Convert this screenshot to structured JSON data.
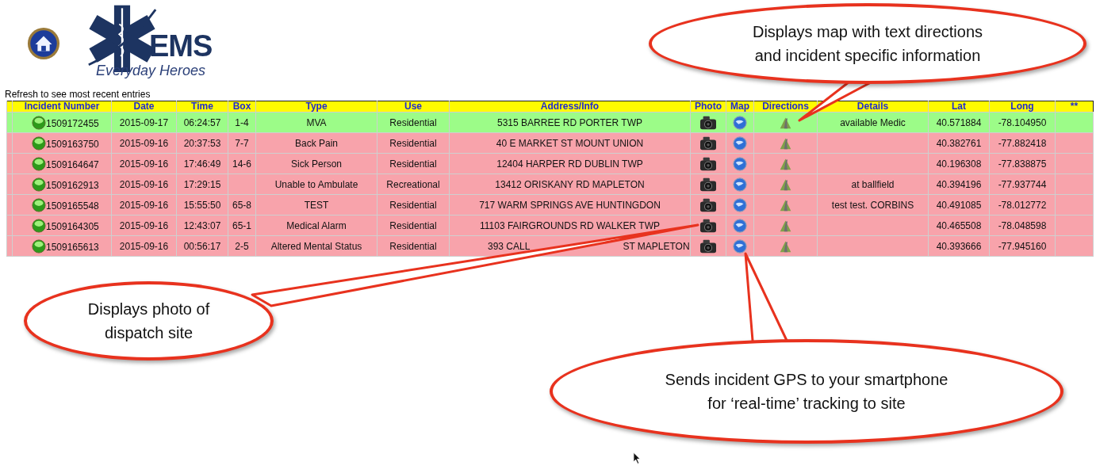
{
  "logo": {
    "title": "EMS",
    "tagline": "Everyday Heroes"
  },
  "refresh_note": "Refresh to see most recent entries",
  "table": {
    "columns": [
      "",
      "Incident Number",
      "Date",
      "Time",
      "Box",
      "Type",
      "Use",
      "Address/Info",
      "Photo",
      "Map",
      "Directions",
      "Details",
      "Lat",
      "Long",
      "**"
    ],
    "rows": [
      {
        "color": "#9cfc88",
        "incident": "1509172455",
        "date": "2015-09-17",
        "time": "06:24:57",
        "box": "1-4",
        "type": "MVA",
        "use": "Residential",
        "address": "5315 BARREE RD PORTER TWP",
        "details": "available Medic",
        "lat": "40.571884",
        "long": "-78.104950"
      },
      {
        "color": "#f8a3ab",
        "incident": "1509163750",
        "date": "2015-09-16",
        "time": "20:37:53",
        "box": "7-7",
        "type": "Back Pain",
        "use": "Residential",
        "address": "40 E MARKET ST MOUNT UNION",
        "details": "",
        "lat": "40.382761",
        "long": "-77.882418"
      },
      {
        "color": "#f8a3ab",
        "incident": "1509164647",
        "date": "2015-09-16",
        "time": "17:46:49",
        "box": "14-6",
        "type": "Sick Person",
        "use": "Residential",
        "address": "12404 HARPER RD DUBLIN TWP",
        "details": "",
        "lat": "40.196308",
        "long": "-77.838875"
      },
      {
        "color": "#f8a3ab",
        "incident": "1509162913",
        "date": "2015-09-16",
        "time": "17:29:15",
        "box": "",
        "type": "Unable to Ambulate",
        "use": "Recreational",
        "address": "13412 ORISKANY RD MAPLETON",
        "details": "at ballfield",
        "lat": "40.394196",
        "long": "-77.937744"
      },
      {
        "color": "#f8a3ab",
        "incident": "1509165548",
        "date": "2015-09-16",
        "time": "15:55:50",
        "box": "65-8",
        "type": "TEST",
        "use": "Residential",
        "address": "717 WARM SPRINGS AVE HUNTINGDON",
        "details": "test test. CORBINS",
        "lat": "40.491085",
        "long": "-78.012772"
      },
      {
        "color": "#f8a3ab",
        "incident": "1509164305",
        "date": "2015-09-16",
        "time": "12:43:07",
        "box": "65-1",
        "type": "Medical Alarm",
        "use": "Residential",
        "address": "11103 FAIRGROUNDS RD WALKER TWP",
        "details": "",
        "lat": "40.465508",
        "long": "-78.048598"
      },
      {
        "color": "#f8a3ab",
        "incident": "1509165613",
        "date": "2015-09-16",
        "time": "00:56:17",
        "box": "2-5",
        "type": "Altered Mental Status",
        "use": "Residential",
        "address": "393 CALL",
        "address_tail": "ST MAPLETON",
        "details": "",
        "lat": "40.393666",
        "long": "-77.945160"
      }
    ]
  },
  "callouts": [
    {
      "kind": "map",
      "lines": [
        "Displays map with text directions",
        "and incident specific information"
      ]
    },
    {
      "kind": "photo",
      "lines": [
        "Displays photo of",
        "dispatch site"
      ]
    },
    {
      "kind": "gps",
      "lines": [
        "Sends incident GPS to your smartphone",
        "for ‘real-time’ tracking to site"
      ]
    }
  ]
}
